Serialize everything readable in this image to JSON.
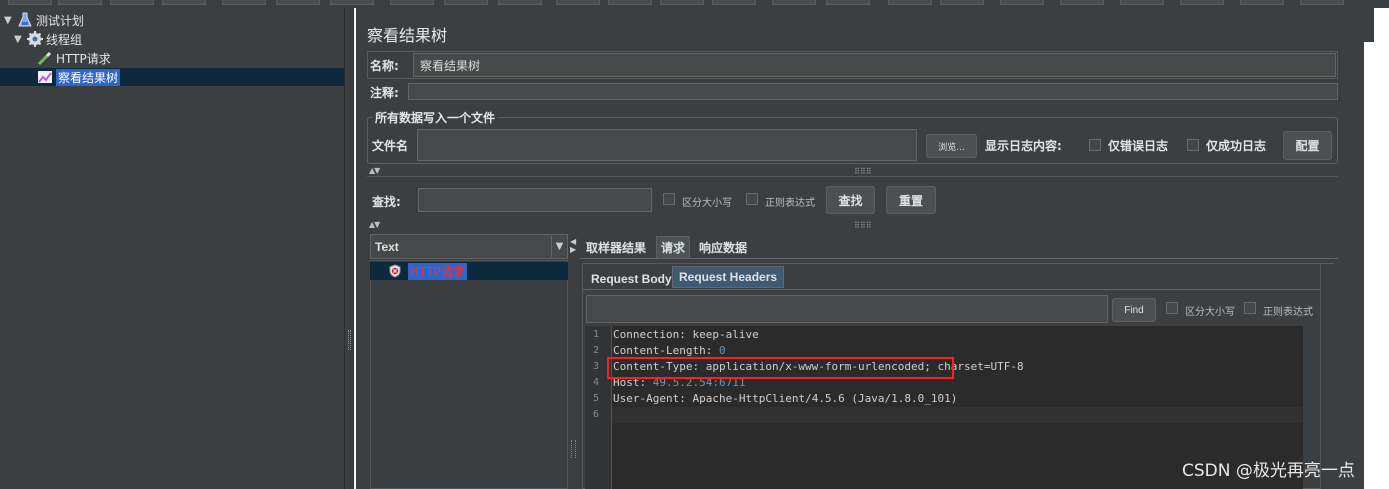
{
  "tree": {
    "items": [
      {
        "label": "测试计划",
        "icon": "test-plan-icon"
      },
      {
        "label": "线程组",
        "icon": "gear-icon"
      },
      {
        "label": "HTTP请求",
        "icon": "pipette-icon"
      },
      {
        "label": "察看结果树",
        "icon": "chart-icon"
      }
    ]
  },
  "panel": {
    "title": "察看结果树",
    "name_label": "名称:",
    "name_value": "察看结果树",
    "comment_label": "注释:",
    "comment_value": ""
  },
  "file_group": {
    "legend": "所有数据写入一个文件",
    "filename_label": "文件名",
    "filename_value": "",
    "browse_button": "浏览...",
    "show_log_label": "显示日志内容:",
    "errors_only_label": "仅错误日志",
    "success_only_label": "仅成功日志",
    "configure_button": "配置"
  },
  "search": {
    "label": "查找:",
    "value": "",
    "case_sensitive_label": "区分大小写",
    "regex_label": "正则表达式",
    "find_button": "查找",
    "reset_button": "重置"
  },
  "results": {
    "renderer": "Text",
    "samples": [
      {
        "label": "HTTP请求",
        "status": "error"
      }
    ]
  },
  "detail_tabs": [
    "取样器结果",
    "请求",
    "响应数据"
  ],
  "request_subtabs": [
    "Request Body",
    "Request Headers"
  ],
  "editor_search": {
    "value": "",
    "find_button": "Find",
    "case_sensitive_label": "区分大小写",
    "regex_label": "正则表达式"
  },
  "headers": {
    "lines": [
      {
        "n": "1",
        "key": "Connection: ",
        "val": "keep-alive"
      },
      {
        "n": "2",
        "key": "Content-Length: ",
        "val": "0"
      },
      {
        "n": "3",
        "key": "Content-Type: ",
        "val": "application/x-www-form-urlencoded; charset=UTF-8"
      },
      {
        "n": "4",
        "key": "Host: ",
        "val": "49.5.2.54:6711"
      },
      {
        "n": "5",
        "key": "User-Agent: ",
        "val": "Apache-HttpClient/4.5.6 (Java/1.8.0_101)"
      },
      {
        "n": "6",
        "key": "",
        "val": ""
      }
    ]
  },
  "watermark": "CSDN @极光再亮一点",
  "colors": {
    "background": "#3c3f41",
    "selection": "#2f65ca",
    "highlight_box": "#ff1d1d",
    "number": "#6897bb",
    "error_text": "#cc3333"
  }
}
